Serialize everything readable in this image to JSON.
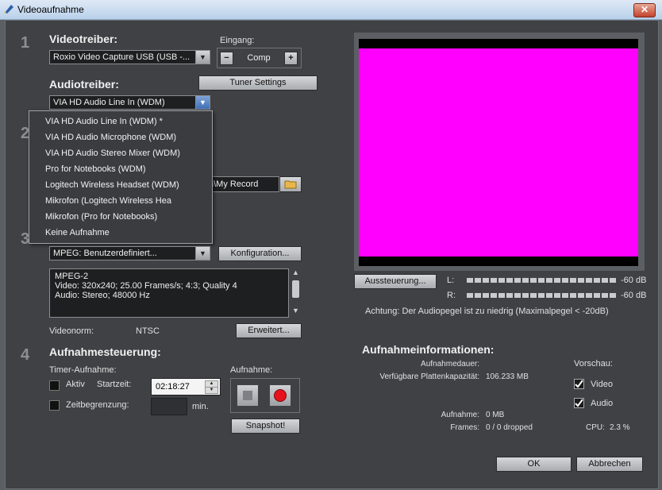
{
  "window": {
    "title": "Videoaufnahme",
    "close_glyph": "✕"
  },
  "steps": [
    "1",
    "2",
    "3",
    "4"
  ],
  "section1": {
    "video_driver_heading": "Videotreiber:",
    "video_driver_value": "Roxio Video Capture USB (USB -...",
    "input_label": "Eingang:",
    "input_minus": "−",
    "input_value": "Comp",
    "input_plus": "+",
    "tuner_button": "Tuner Settings",
    "audio_driver_heading": "Audiotreiber:",
    "audio_driver_value": "VIA HD Audio Line In (WDM)"
  },
  "audio_dropdown": {
    "items": [
      "VIA HD Audio Line In (WDM) *",
      "VIA HD Audio Microphone (WDM)",
      "VIA HD Audio Stereo Mixer (WDM)",
      "Pro for Notebooks (WDM)",
      "Logitech Wireless Headset (WDM)",
      "Mikrofon (Logitech Wireless Hea",
      "Mikrofon (Pro for Notebooks)",
      "Keine Aufnahme"
    ]
  },
  "section2": {
    "path_value": "n\\My Record",
    "folder_icon": "folder-icon"
  },
  "section3": {
    "format_value": "MPEG: Benutzerdefiniert...",
    "config_button": "Konfiguration...",
    "info_lines": [
      "MPEG-2",
      "Video: 320x240; 25.00 Frames/s; 4:3; Quality 4",
      "Audio: Stereo; 48000 Hz"
    ],
    "videonorm_label": "Videonorm:",
    "videonorm_value": "NTSC",
    "extended_button": "Erweitert..."
  },
  "section4": {
    "heading": "Aufnahmesteuerung:",
    "timer_label": "Timer-Aufnahme:",
    "active_label": "Aktiv",
    "start_label": "Startzeit:",
    "start_value": "02:18:27",
    "limit_label": "Zeitbegrenzung:",
    "minutes_label": "min.",
    "record_label": "Aufnahme:",
    "snapshot_button": "Snapshot!"
  },
  "preview": {
    "level_button": "Aussteuerung...",
    "left_label": "L:",
    "right_label": "R:",
    "left_db": "-60 dB",
    "right_db": "-60 dB",
    "warning": "Achtung: Der Audiopegel ist zu niedrig (Maximalpegel < -20dB)"
  },
  "info": {
    "heading": "Aufnahmeinformationen:",
    "duration_label": "Aufnahmedauer:",
    "duration_value": "",
    "capacity_label": "Verfügbare Plattenkapazität:",
    "capacity_value": "106.233 MB",
    "recording_label": "Aufnahme:",
    "recording_value": "0 MB",
    "frames_label": "Frames:",
    "frames_value": "0 / 0 dropped",
    "cpu_label": "CPU:",
    "cpu_value": "2.3 %"
  },
  "preview_opts": {
    "heading": "Vorschau:",
    "video_label": "Video",
    "audio_label": "Audio",
    "video_checked": true,
    "audio_checked": true
  },
  "footer": {
    "ok": "OK",
    "cancel": "Abbrechen"
  },
  "colors": {
    "preview_fill": "#ff00ff",
    "record_red": "#e8121c"
  }
}
